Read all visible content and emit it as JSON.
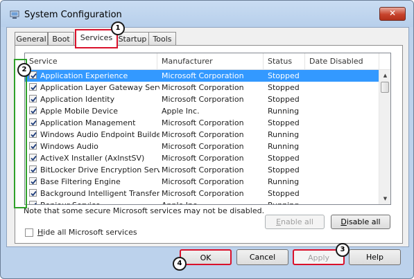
{
  "window": {
    "title": "System Configuration",
    "close_glyph": "✕"
  },
  "tabs": [
    {
      "label": "General"
    },
    {
      "label": "Boot"
    },
    {
      "label": "Services"
    },
    {
      "label": "Startup"
    },
    {
      "label": "Tools"
    }
  ],
  "columns": [
    "Service",
    "Manufacturer",
    "Status",
    "Date Disabled"
  ],
  "rows": [
    {
      "service": "Application Experience",
      "manufacturer": "Microsoft Corporation",
      "status": "Stopped",
      "checked": true,
      "selected": true
    },
    {
      "service": "Application Layer Gateway Service",
      "manufacturer": "Microsoft Corporation",
      "status": "Stopped",
      "checked": true
    },
    {
      "service": "Application Identity",
      "manufacturer": "Microsoft Corporation",
      "status": "Stopped",
      "checked": true
    },
    {
      "service": "Apple Mobile Device",
      "manufacturer": "Apple Inc.",
      "status": "Running",
      "checked": true
    },
    {
      "service": "Application Management",
      "manufacturer": "Microsoft Corporation",
      "status": "Stopped",
      "checked": true
    },
    {
      "service": "Windows Audio Endpoint Builder",
      "manufacturer": "Microsoft Corporation",
      "status": "Running",
      "checked": true
    },
    {
      "service": "Windows Audio",
      "manufacturer": "Microsoft Corporation",
      "status": "Running",
      "checked": true
    },
    {
      "service": "ActiveX Installer (AxInstSV)",
      "manufacturer": "Microsoft Corporation",
      "status": "Stopped",
      "checked": true
    },
    {
      "service": "BitLocker Drive Encryption Service",
      "manufacturer": "Microsoft Corporation",
      "status": "Stopped",
      "checked": true
    },
    {
      "service": "Base Filtering Engine",
      "manufacturer": "Microsoft Corporation",
      "status": "Running",
      "checked": true
    },
    {
      "service": "Background Intelligent Transfer ...",
      "manufacturer": "Microsoft Corporation",
      "status": "Stopped",
      "checked": true
    },
    {
      "service": "Bonjour Service",
      "manufacturer": "Apple Inc.",
      "status": "Running",
      "checked": true
    }
  ],
  "scroll": {
    "up": "▲",
    "down": "▼"
  },
  "note": "Note that some secure Microsoft services may not be disabled.",
  "buttons": {
    "enable_all": {
      "mnemonic": "E",
      "rest": "nable all"
    },
    "disable_all": {
      "mnemonic": "D",
      "rest": "isable all"
    },
    "ok": "OK",
    "cancel": "Cancel",
    "apply": "Apply",
    "help": "Help"
  },
  "hide_ms": {
    "mnemonic": "H",
    "rest": "ide all Microsoft services",
    "checked": false
  },
  "badges": [
    "1",
    "2",
    "3",
    "4"
  ],
  "colors": {
    "highlight_red": "#d9112b",
    "highlight_green": "#2fa12a",
    "selection": "#3399ff"
  }
}
